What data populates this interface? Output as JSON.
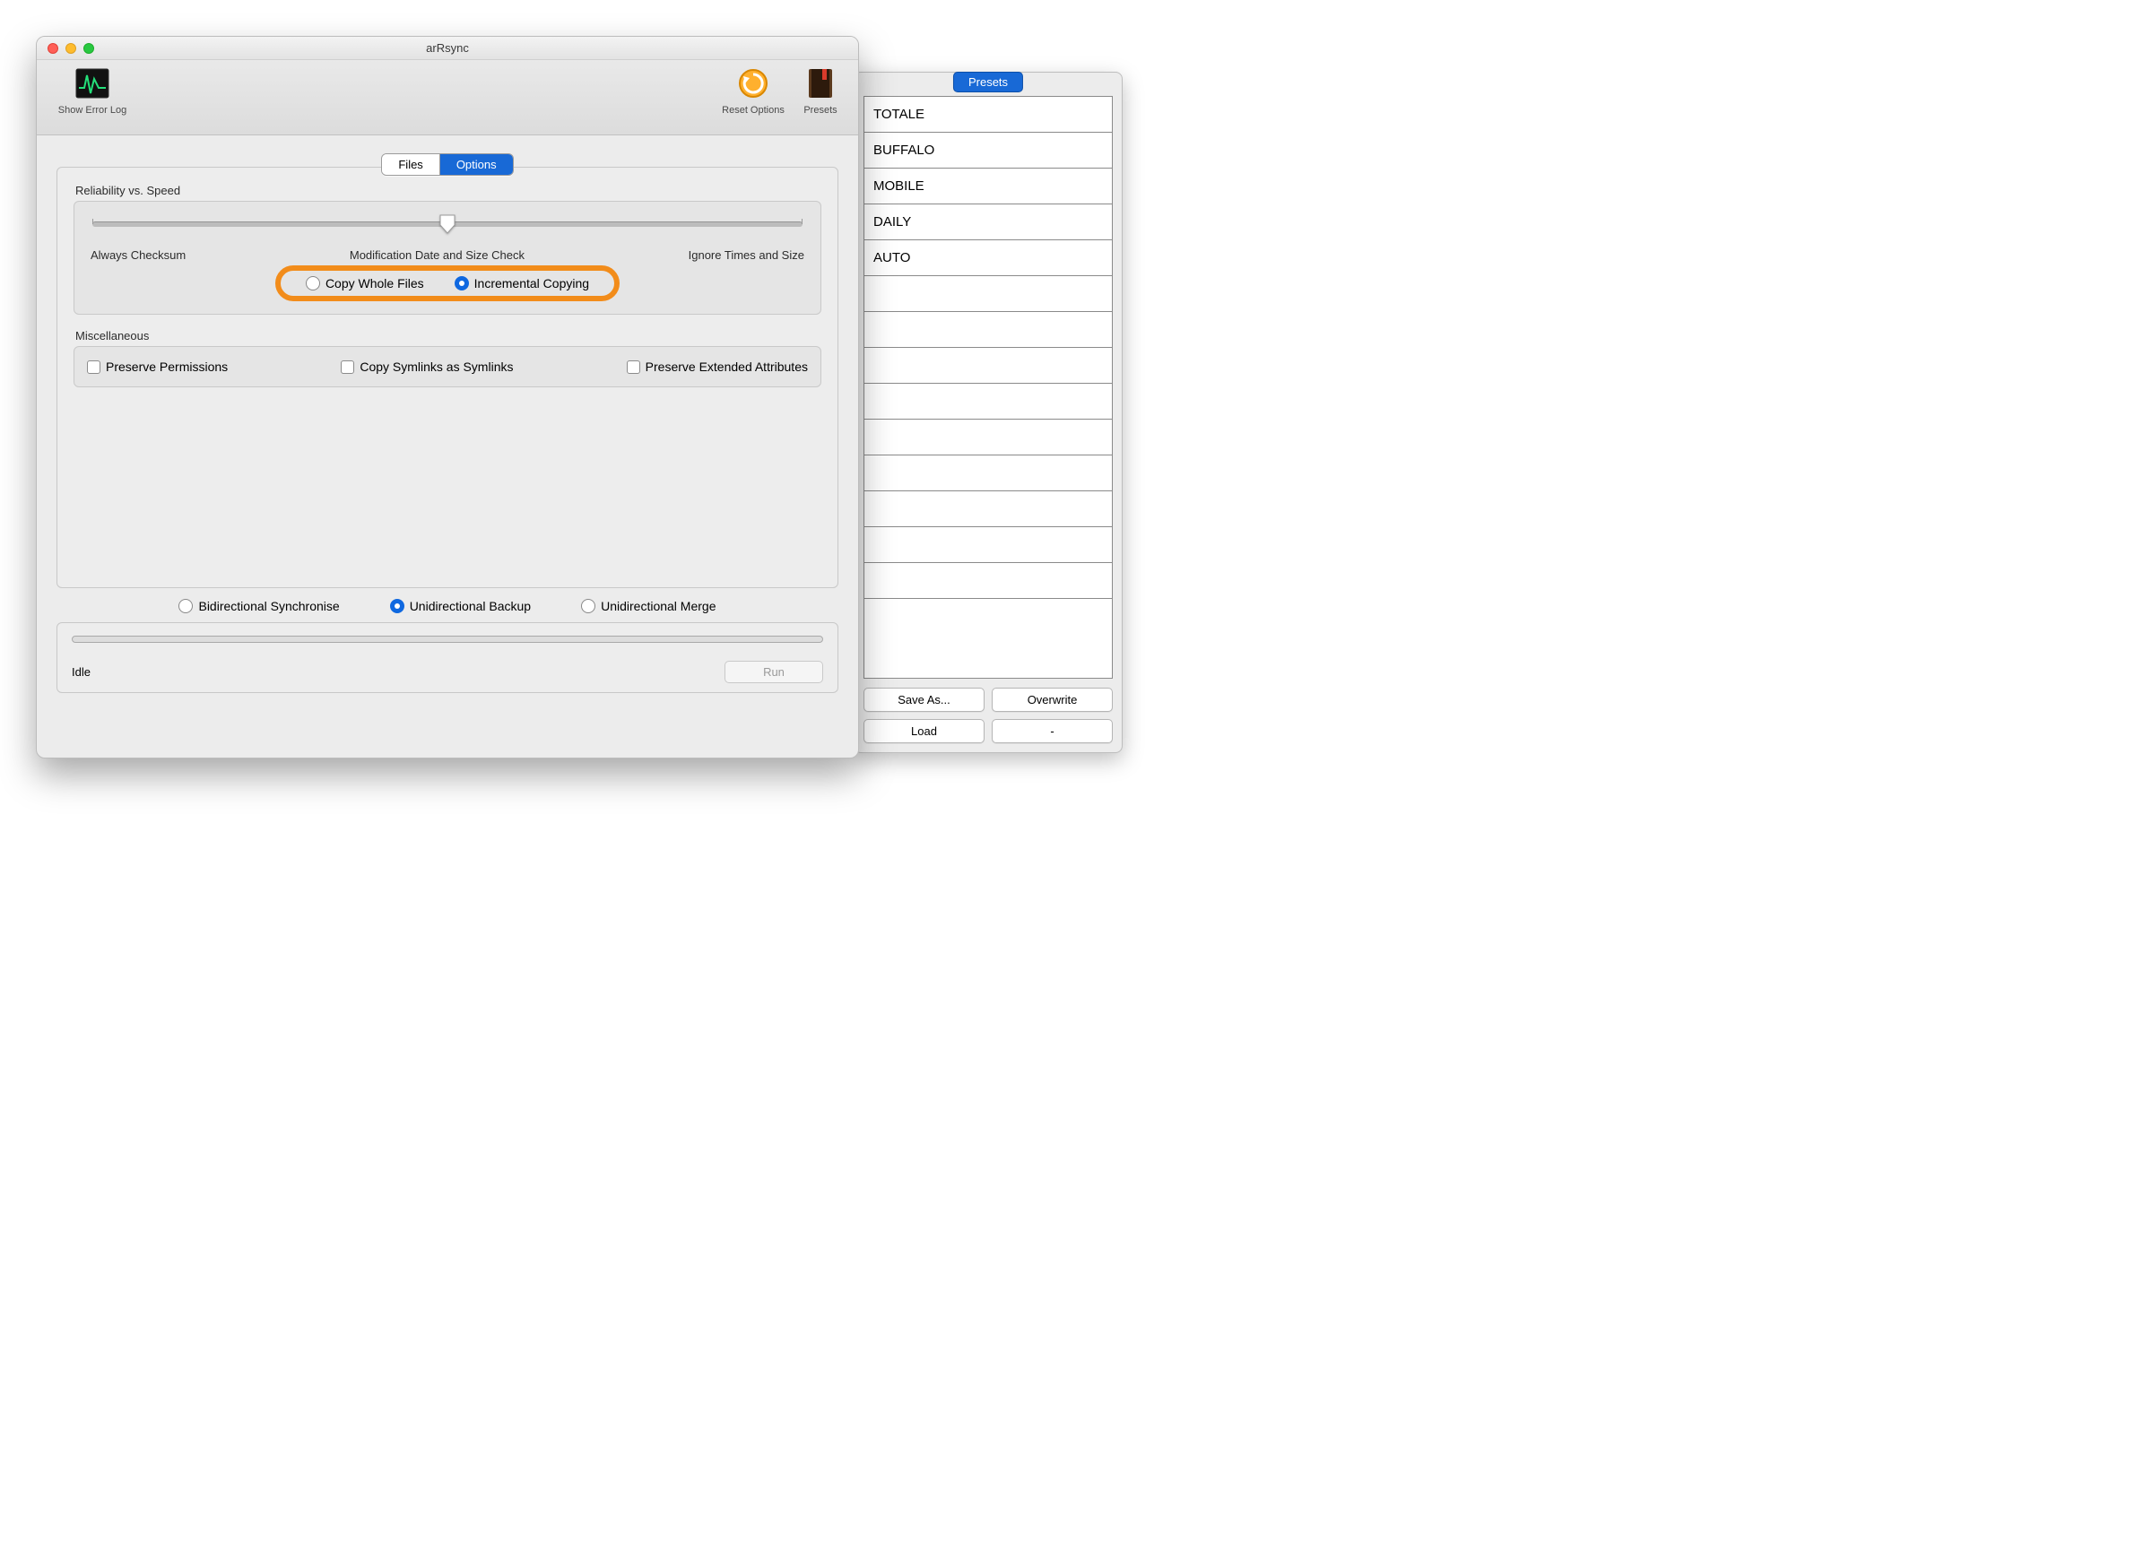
{
  "window": {
    "title": "arRsync"
  },
  "toolbar": {
    "show_error_log": "Show Error Log",
    "reset_options": "Reset Options",
    "presets": "Presets"
  },
  "tabs": {
    "files": "Files",
    "options": "Options",
    "active": "Options"
  },
  "reliability": {
    "legend": "Reliability vs. Speed",
    "left": "Always Checksum",
    "center": "Modification Date and Size Check",
    "right": "Ignore Times and Size",
    "copy_whole": "Copy Whole Files",
    "incremental": "Incremental Copying",
    "selected": "incremental"
  },
  "misc": {
    "legend": "Miscellaneous",
    "preserve_permissions": "Preserve Permissions",
    "copy_symlinks": "Copy Symlinks as Symlinks",
    "preserve_xattrs": "Preserve Extended Attributes"
  },
  "mode": {
    "bidir": "Bidirectional Synchronise",
    "uni_backup": "Unidirectional Backup",
    "uni_merge": "Unidirectional Merge",
    "selected": "uni_backup"
  },
  "footer": {
    "status": "Idle",
    "run": "Run"
  },
  "presets_panel": {
    "title": "Presets",
    "items": [
      "TOTALE",
      "BUFFALO",
      "MOBILE",
      "DAILY",
      "AUTO"
    ],
    "save_as": "Save As...",
    "overwrite": "Overwrite",
    "load": "Load",
    "delete": "-"
  }
}
